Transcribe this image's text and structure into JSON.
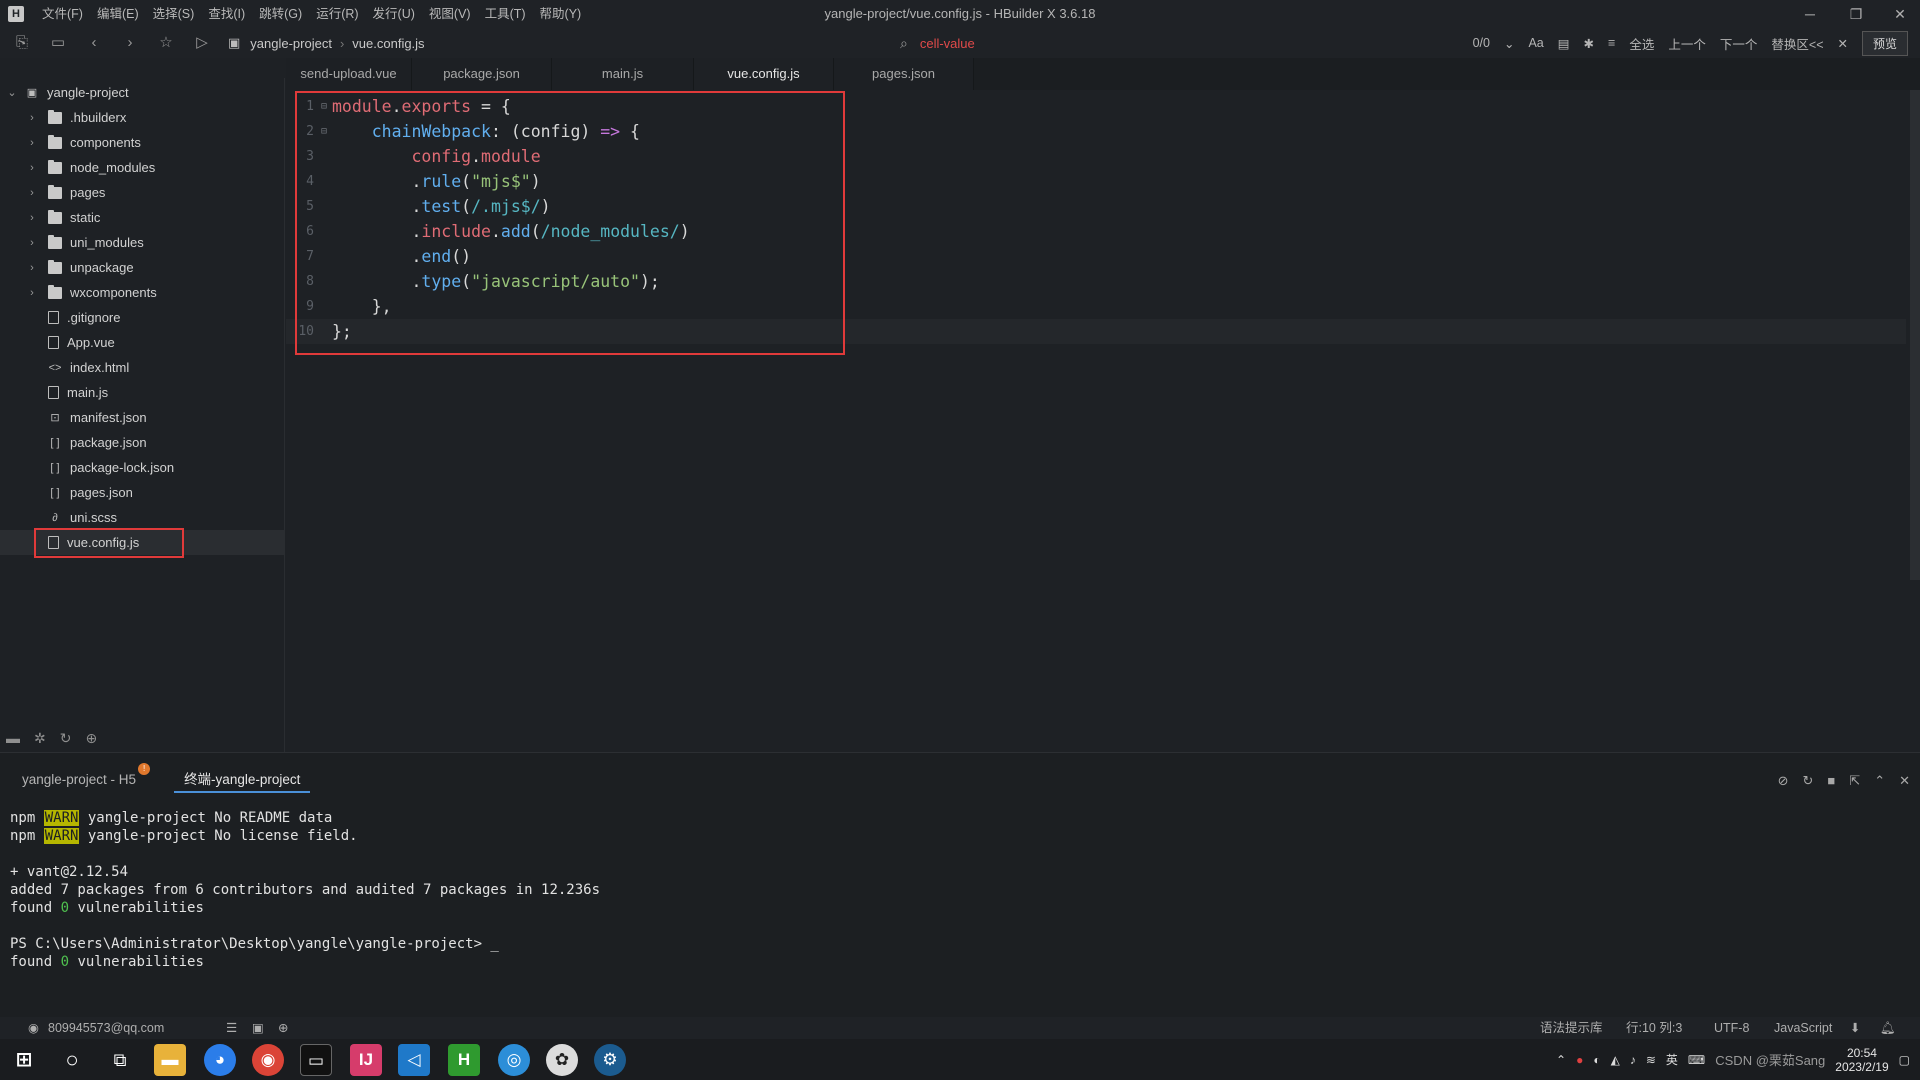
{
  "window": {
    "title": "yangle-project/vue.config.js - HBuilder X 3.6.18",
    "menu": [
      "文件(F)",
      "编辑(E)",
      "选择(S)",
      "查找(I)",
      "跳转(G)",
      "运行(R)",
      "发行(U)",
      "视图(V)",
      "工具(T)",
      "帮助(Y)"
    ],
    "controls": [
      "─",
      "❐",
      "✕"
    ]
  },
  "toolbar": {
    "breadcrumb": [
      "yangle-project",
      "vue.config.js"
    ],
    "find_value": "cell-value",
    "match_count": "0/0",
    "select_all": "全选",
    "prev": "上一个",
    "next": "下一个",
    "replace": "替换区<<",
    "preview": "预览"
  },
  "sidebar": {
    "root": "yangle-project",
    "items": [
      {
        "label": ".hbuilderx",
        "type": "folder"
      },
      {
        "label": "components",
        "type": "folder"
      },
      {
        "label": "node_modules",
        "type": "folder"
      },
      {
        "label": "pages",
        "type": "folder"
      },
      {
        "label": "static",
        "type": "folder"
      },
      {
        "label": "uni_modules",
        "type": "folder"
      },
      {
        "label": "unpackage",
        "type": "folder"
      },
      {
        "label": "wxcomponents",
        "type": "folder"
      },
      {
        "label": ".gitignore",
        "type": "file"
      },
      {
        "label": "App.vue",
        "type": "file"
      },
      {
        "label": "index.html",
        "type": "html"
      },
      {
        "label": "main.js",
        "type": "file"
      },
      {
        "label": "manifest.json",
        "type": "manifest"
      },
      {
        "label": "package.json",
        "type": "json"
      },
      {
        "label": "package-lock.json",
        "type": "json"
      },
      {
        "label": "pages.json",
        "type": "json"
      },
      {
        "label": "uni.scss",
        "type": "scss"
      },
      {
        "label": "vue.config.js",
        "type": "file"
      }
    ]
  },
  "tabs": [
    "send-upload.vue",
    "package.json",
    "main.js",
    "vue.config.js",
    "pages.json"
  ],
  "active_tab": "vue.config.js",
  "editor": {
    "line_numbers": [
      "1",
      "2",
      "3",
      "4",
      "5",
      "6",
      "7",
      "8",
      "9",
      "10"
    ],
    "code": [
      "module.exports = {",
      "    chainWebpack: (config) => {",
      "        config.module",
      "        .rule(\"mjs$\")",
      "        .test(/.mjs$/)",
      "        .include.add(/node_modules/)",
      "        .end()",
      "        .type(\"javascript/auto\");",
      "    },",
      "};"
    ]
  },
  "terminal": {
    "tabs": [
      "yangle-project - H5",
      "终端-yangle-project"
    ],
    "badge": "!",
    "lines": {
      "l1_prefix": "npm ",
      "l1_warn": "WARN",
      "l1_text": " yangle-project No README data",
      "l2_prefix": "npm ",
      "l2_warn": "WARN",
      "l2_text": " yangle-project No license field.",
      "l3": "+ vant@2.12.54",
      "l4": "added 7 packages from 6 contributors and audited 7 packages in 12.236s",
      "l5_a": "found ",
      "l5_num": "0",
      "l5_b": " vulnerabilities",
      "l6": "PS C:\\Users\\Administrator\\Desktop\\yangle\\yangle-project> _",
      "l7_a": "found ",
      "l7_num": "0",
      "l7_b": " vulnerabilities"
    }
  },
  "statusbar": {
    "account": "809945573@qq.com",
    "syntax_lib": "语法提示库",
    "position": "行:10  列:3",
    "encoding": "UTF-8",
    "language": "JavaScript"
  },
  "taskbar": {
    "ime": "英",
    "time": "20:54",
    "date": "2023/2/19",
    "watermark": "CSDN @栗茹Sang"
  },
  "colors": {
    "highlight_box": "#e03a3a",
    "find_text": "#e04a4a",
    "warn_bg": "#b5b600"
  }
}
